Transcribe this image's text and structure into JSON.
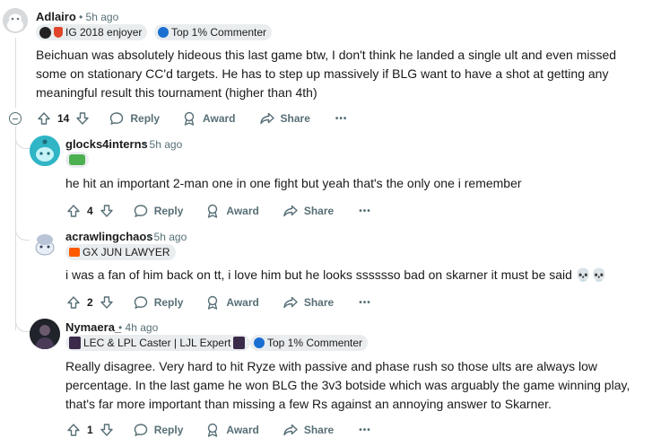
{
  "comments": [
    {
      "username": "Adlairo",
      "time": "5h ago",
      "flair_1": "IG 2018 enjoyer",
      "flair_2": "Top 1% Commenter",
      "text": "Beichuan was absolutely hideous this last game btw, I don't think he landed a single ult and even missed some on stationary CC'd targets. He has to step up massively if BLG want to have a shot at getting any meaningful result this tournament (higher than 4th)",
      "votes": "14",
      "reply_label": "Reply",
      "award_label": "Award",
      "share_label": "Share",
      "more_label": "•••"
    },
    {
      "username": "glocks4interns",
      "time": "5h ago",
      "text": "he hit an important 2-man one in one fight but yeah that's the only one i remember",
      "votes": "4",
      "reply_label": "Reply",
      "award_label": "Award",
      "share_label": "Share",
      "more_label": "•••"
    },
    {
      "username": "acrawlingchaos",
      "time": "5h ago",
      "flair_1": "GX JUN LAWYER",
      "text": "i was a fan of him back on tt, i love him but he looks sssssso bad on skarner it must be said 💀💀",
      "votes": "2",
      "reply_label": "Reply",
      "award_label": "Award",
      "share_label": "Share",
      "more_label": "•••"
    },
    {
      "username": "Nymaera_",
      "time": "4h ago",
      "flair_1": "LEC & LPL Caster | LJL Expert",
      "flair_2": "Top 1% Commenter",
      "text": "Really disagree. Very hard to hit Ryze with passive and phase rush so those ults are always low percentage. In the last game he won BLG the 3v3 botside which was arguably the game winning play, that's far more important than missing a few Rs against an annoying answer to Skarner.",
      "votes": "1",
      "reply_label": "Reply",
      "award_label": "Award",
      "share_label": "Share",
      "more_label": "•••"
    }
  ],
  "separator": "•",
  "colors": {
    "text": "#1a1a1b",
    "meta": "#576f76",
    "flair_bg": "#eaedef",
    "thread_line": "#d9dde0",
    "top_commenter_icon": "#1a6fd1"
  },
  "icons": [
    "upvote-icon",
    "downvote-icon",
    "reply-icon",
    "award-icon",
    "share-icon",
    "collapse-icon"
  ]
}
